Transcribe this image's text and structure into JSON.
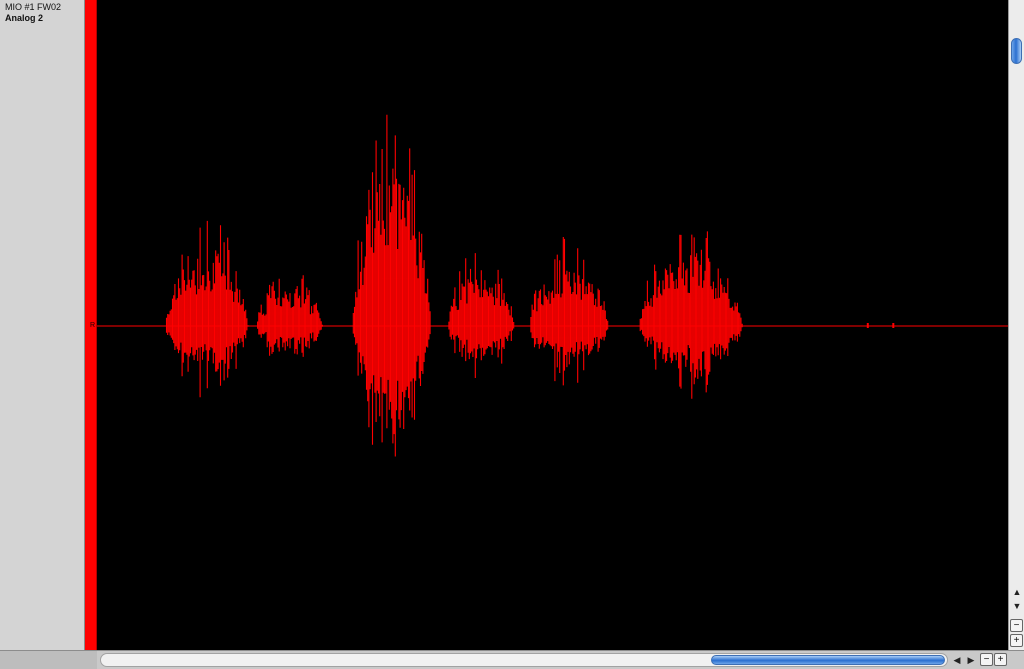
{
  "track": {
    "device_name": "MIO #1 FW02",
    "channel_name": "Analog 2",
    "channel_marker": "R",
    "color": "#ff0000"
  },
  "scrollbars": {
    "up_icon": "▲",
    "down_icon": "▼",
    "left_icon": "◀",
    "right_icon": "▶",
    "zoom_out_icon": "−",
    "zoom_in_icon": "+"
  },
  "waveform": {
    "color": "#ff0000",
    "background": "#000000",
    "bursts": [
      {
        "start": 0.075,
        "end": 0.175,
        "peak": 0.34
      },
      {
        "start": 0.175,
        "end": 0.255,
        "peak": 0.18
      },
      {
        "start": 0.28,
        "end": 0.375,
        "peak": 0.68
      },
      {
        "start": 0.385,
        "end": 0.465,
        "peak": 0.25
      },
      {
        "start": 0.475,
        "end": 0.57,
        "peak": 0.28
      },
      {
        "start": 0.595,
        "end": 0.72,
        "peak": 0.32
      }
    ]
  }
}
